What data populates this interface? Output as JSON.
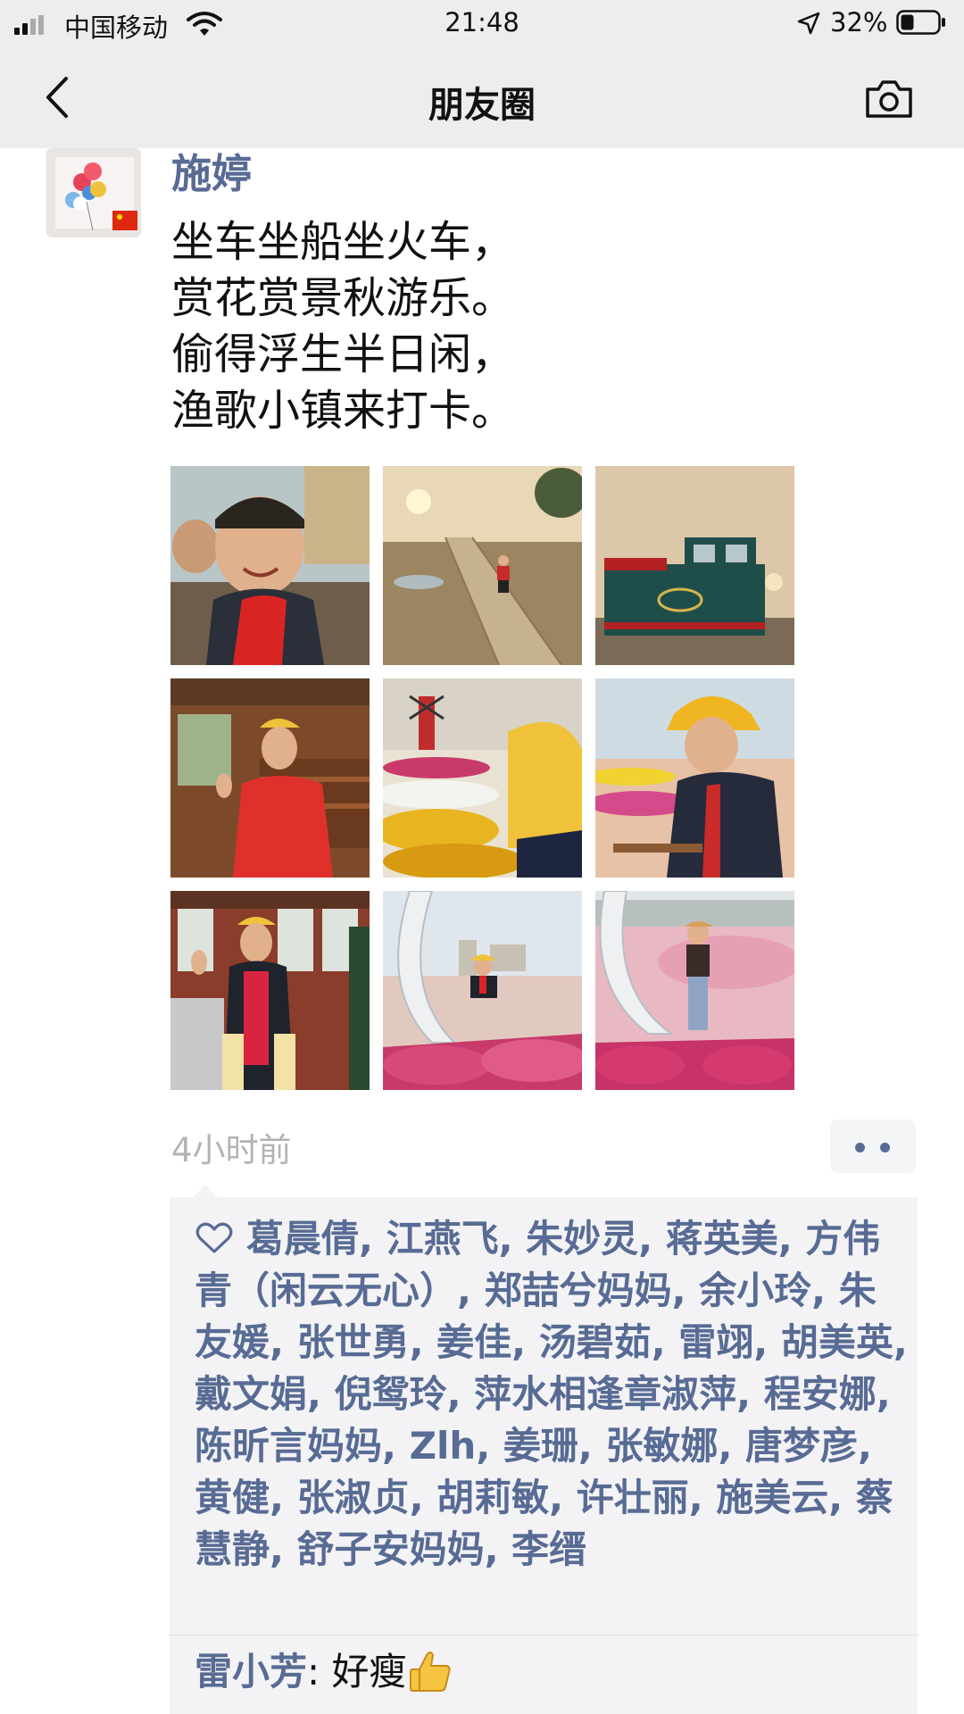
{
  "status_bar": {
    "carrier": "中国移动",
    "time": "21:48",
    "battery": "32%"
  },
  "nav": {
    "title": "朋友圈",
    "back_icon": "chevron-left-icon",
    "camera_icon": "camera-icon"
  },
  "post": {
    "author": "施婷",
    "lines": [
      "坐车坐船坐火车，",
      "赏花赏景秋游乐。",
      "偷得浮生半日闲，",
      "渔歌小镇来打卡。"
    ],
    "time_ago": "4小时前",
    "photo_count": 9
  },
  "likes": {
    "text": "葛晨倩, 江燕飞, 朱妙灵, 蒋英美, 方伟青（闲云无心）, 郑喆兮妈妈, 余小玲, 朱友媛, 张世勇, 姜佳, 汤碧茹, 雷翊, 胡美英, 戴文娟, 倪鸳玲, 萍水相逢章淑萍, 程安娜, 陈昕言妈妈, Zlh, 姜珊, 张敏娜, 唐梦彦, 黄健, 张淑贞, 胡莉敏, 许壮丽, 施美云, 蔡慧静, 舒子安妈妈, 李缙"
  },
  "comment": {
    "name": "雷小芳",
    "separator": ": ",
    "text": "好瘦"
  }
}
